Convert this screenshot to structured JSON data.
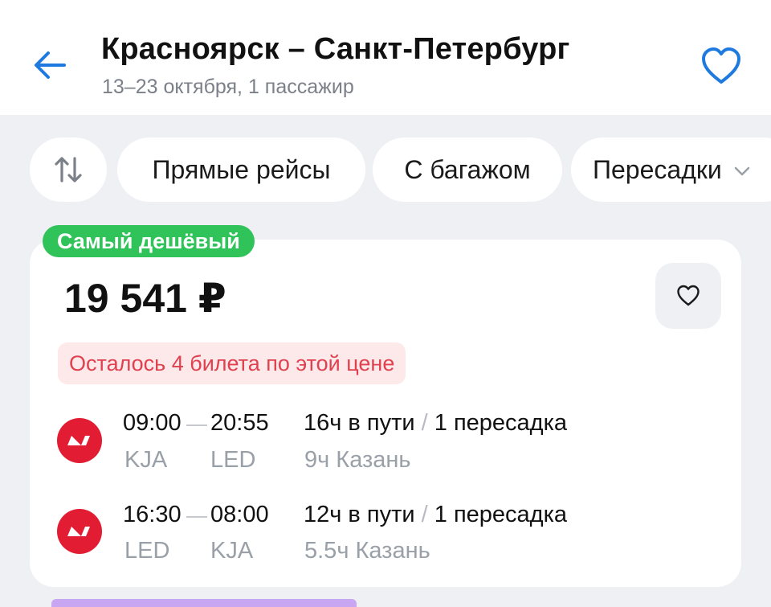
{
  "header": {
    "title": "Красноярск – Санкт-Петербург",
    "subtitle": "13–23 октября, 1 пассажир",
    "back_icon": "arrow-left-icon",
    "favorite_icon": "heart-outline-icon",
    "accent_color": "#1f7ae0"
  },
  "filters": {
    "sort_icon": "sort-arrows-icon",
    "chips": [
      "Прямые рейсы",
      "С багажом",
      "Пересадки"
    ]
  },
  "offer": {
    "badge": "Самый дешёвый",
    "badge_color": "#2fc35a",
    "price": "19 541 ₽",
    "warning": "Осталось 4 билета по этой цене",
    "warning_color": "#e0414f",
    "airline_logo_color": "#e21d33",
    "segments": [
      {
        "depart_time": "09:00",
        "arrive_time": "20:55",
        "depart_airport": "KJA",
        "arrive_airport": "LED",
        "duration": "16ч в пути",
        "stops": "1 пересадка",
        "layover": "9ч Казань"
      },
      {
        "depart_time": "16:30",
        "arrive_time": "08:00",
        "depart_airport": "LED",
        "arrive_airport": "KJA",
        "duration": "12ч в пути",
        "stops": "1 пересадка",
        "layover": "5.5ч Казань"
      }
    ]
  }
}
